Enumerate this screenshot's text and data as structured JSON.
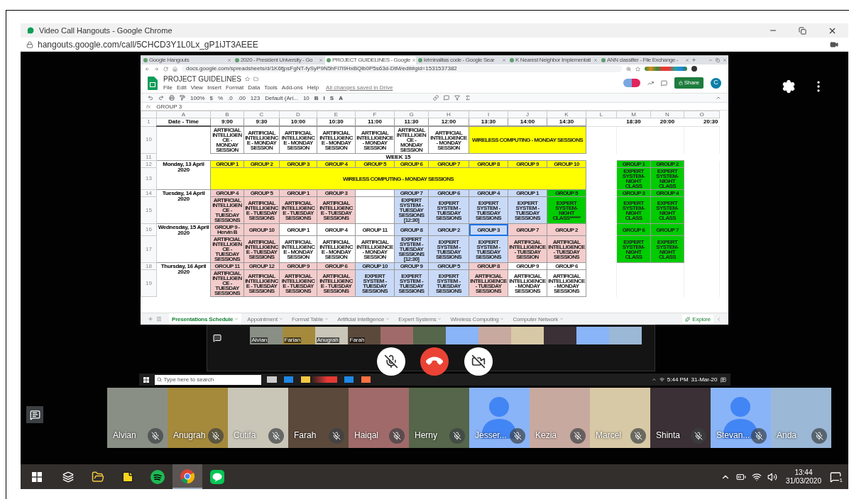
{
  "window": {
    "title": "Video Call Hangouts - Google Chrome",
    "url": "hangouts.google.com/call/5CHCD3Y1L0Lx_gP1iJT3AEEE"
  },
  "shared_screen": {
    "browser_tabs": [
      {
        "title": "Google Hangouts",
        "selected": false
      },
      {
        "title": "2020 - President University - Go",
        "selected": false
      },
      {
        "title": "PROJECT GUIDELINES - Google",
        "selected": true
      },
      {
        "title": "kriminalitas code - Google Sear",
        "selected": false
      },
      {
        "title": "K Nearest Neighbor Implementati",
        "selected": false
      },
      {
        "title": "ANN classifier - File Exchange -",
        "selected": false
      }
    ],
    "url": "docs.google.com/spreadsheets/d/1K6fjpsFgNT-fySyP9N5hFi7l9HxBQlb0P5s63d-DtM/edit#gid=1531537382",
    "doc_title": "PROJECT GUIDELINES",
    "menu": [
      "File",
      "Edit",
      "View",
      "Insert",
      "Format",
      "Data",
      "Tools",
      "Add-ons",
      "Help"
    ],
    "save_status": "All changes saved in Drive",
    "share": "Share",
    "account": "C",
    "toolbar": [
      "100%",
      "$",
      "%",
      ".0",
      ".00",
      "123",
      "Default (Ari...",
      "10",
      "B",
      "I",
      "S",
      "A"
    ],
    "formula_label": "fx",
    "formula": "GROUP 3",
    "columns": [
      "A",
      "B",
      "C",
      "D",
      "E",
      "F",
      "G",
      "H",
      "I",
      "J",
      "K",
      "L",
      "M",
      "N",
      "O"
    ],
    "rows": [
      {
        "number": "1",
        "kind": "header",
        "date": "Date - Time",
        "times": [
          "9:00",
          "9:30",
          "10:00",
          "10:30",
          "11:00",
          "11:30",
          "12:00",
          "13:30",
          "14:00",
          "14:30"
        ],
        "night_times": [
          "18:30",
          "20:00",
          "20:30"
        ]
      },
      {
        "number": "10",
        "kind": "schedule",
        "cells": [
          {
            "kind": "cell",
            "text": "ARTIFICIAL INTELLIGENCE - MONDAY SESSION",
            "color": "#ffffff",
            "selected": false
          },
          {
            "kind": "cell",
            "text": "ARTIFICIAL INTELLIGENCE - MONDAY SESSION",
            "color": "#ffffff",
            "selected": false
          },
          {
            "kind": "cell",
            "text": "ARTIFICIAL INTELLIGENCE - MONDAY SESSION",
            "color": "#ffffff",
            "selected": false
          },
          {
            "kind": "cell",
            "text": "ARTIFICIAL INTELLIGENCE - MONDAY SESSION",
            "color": "#ffffff",
            "selected": false
          },
          {
            "kind": "cell",
            "text": "ARTIFICIAL INTELLIGENCE - MONDAY SESSION",
            "color": "#ffffff",
            "selected": false
          },
          {
            "kind": "cell",
            "text": "ARTIFICIAL INTELLIGENCE - MONDAY SESSION",
            "color": "#ffffff",
            "selected": false
          },
          {
            "kind": "cell",
            "text": "ARTIFICIAL INTELLIGENCE - MONDAY SESSION",
            "color": "#ffffff",
            "selected": false
          },
          {
            "kind": "wide",
            "text": "WIRELESS COMPUTING - MONDAY SESSIONS",
            "color": "#ffff00",
            "selected": false
          }
        ]
      },
      {
        "number": "11",
        "kind": "banner",
        "text": "WEEK 15"
      },
      {
        "number": "12",
        "kind": "schedule",
        "date": "Monday, 13 April 2020",
        "cells": [
          {
            "kind": "cell",
            "text": "GROUP 1",
            "color": "#ffff00",
            "selected": false
          },
          {
            "kind": "cell",
            "text": "GROUP 2",
            "color": "#ffff00",
            "selected": false
          },
          {
            "kind": "cell",
            "text": "GROUP 3",
            "color": "#ffff00",
            "selected": false
          },
          {
            "kind": "cell",
            "text": "GROUP 4",
            "color": "#ffff00",
            "selected": false
          },
          {
            "kind": "cell",
            "text": "GROUP 5",
            "color": "#ffff00",
            "selected": false
          },
          {
            "kind": "cell",
            "text": "GROUP 6",
            "color": "#ffff00",
            "selected": false
          },
          {
            "kind": "cell",
            "text": "GROUP 7",
            "color": "#ffff00",
            "selected": false
          },
          {
            "kind": "cell",
            "text": "GROUP 8",
            "color": "#ffff00",
            "selected": false
          },
          {
            "kind": "cell",
            "text": "GROUP 9",
            "color": "#ffff00",
            "selected": false
          },
          {
            "kind": "cell",
            "text": "GROUP 10",
            "color": "#ffff00",
            "selected": false
          }
        ],
        "night": [
          {
            "text": "GROUP 1",
            "color": "#00cc00",
            "selected": false
          },
          {
            "text": "GROUP 2",
            "color": "#00cc00",
            "selected": false
          }
        ]
      },
      {
        "number": "13",
        "kind": "schedule",
        "cells": [
          {
            "kind": "wide",
            "text": "WIRELESS COMPUTING - MONDAY SESSIONS",
            "color": "#ffff00",
            "selected": false
          }
        ],
        "night": [
          {
            "text": "EXPERT SYSTEM- NIGHT CLASS",
            "color": "#00cc00",
            "selected": false
          },
          {
            "text": "EXPERT SYSTEM- NIGHT CLASS",
            "color": "#00cc00",
            "selected": false
          }
        ]
      },
      {
        "number": "14",
        "kind": "schedule",
        "date": "Tuesday, 14 April 2020",
        "cells": [
          {
            "kind": "cell",
            "text": "GROUP 4",
            "color": "#f4cccc",
            "selected": false
          },
          {
            "kind": "cell",
            "text": "GROUP 5",
            "color": "#f4cccc",
            "selected": false
          },
          {
            "kind": "cell",
            "text": "GROUP 1",
            "color": "#f4cccc",
            "selected": false
          },
          {
            "kind": "cell",
            "text": "GROUP 3",
            "color": "#f4cccc",
            "selected": false
          },
          {
            "kind": "blank",
            "color": "#ffffff",
            "selected": false
          },
          {
            "kind": "cell",
            "text": "GROUP 7",
            "color": "#c9daf8",
            "selected": false
          },
          {
            "kind": "cell",
            "text": "GROUP 6",
            "color": "#c9daf8",
            "selected": false
          },
          {
            "kind": "cell",
            "text": "GROUP 4",
            "color": "#c9daf8",
            "selected": false
          },
          {
            "kind": "cell",
            "text": "GROUP 1",
            "color": "#c9daf8",
            "selected": false
          },
          {
            "kind": "cell",
            "text": "GROUP 5",
            "color": "#00cc00",
            "selected": false
          }
        ],
        "night": [
          {
            "text": "GROUP 3",
            "color": "#00cc00",
            "selected": false
          },
          {
            "text": "GROUP 4",
            "color": "#00cc00",
            "selected": false
          }
        ]
      },
      {
        "number": "15",
        "kind": "schedule",
        "cells": [
          {
            "kind": "cell",
            "text": "ARTIFICIAL INTELLIGENCE - TUESDAY SESSIONS",
            "color": "#f4cccc",
            "selected": false
          },
          {
            "kind": "cell",
            "text": "ARTIFICIAL INTELLIGENCE - TUESDAY SESSIONS",
            "color": "#f4cccc",
            "selected": false
          },
          {
            "kind": "cell",
            "text": "ARTIFICIAL INTELLIGENCE - TUESDAY SESSIONS",
            "color": "#f4cccc",
            "selected": false
          },
          {
            "kind": "cell",
            "text": "ARTIFICIAL INTELLIGENCE - TUESDAY SESSIONS",
            "color": "#f4cccc",
            "selected": false
          },
          {
            "kind": "blank",
            "color": "#ffffff",
            "selected": false
          },
          {
            "kind": "cell",
            "text": "EXPERT SYSTEM - TUESDAY SESSIONS [12:30]",
            "color": "#c9daf8",
            "selected": false
          },
          {
            "kind": "cell",
            "text": "EXPERT SYSTEM - TUESDAY SESSIONS",
            "color": "#c9daf8",
            "selected": false
          },
          {
            "kind": "cell",
            "text": "EXPERT SYSTEM - TUESDAY SESSIONS",
            "color": "#c9daf8",
            "selected": false
          },
          {
            "kind": "cell",
            "text": "EXPERT SYSTEM - TUESDAY SESSIONS",
            "color": "#c9daf8",
            "selected": false
          },
          {
            "kind": "cell",
            "text": "EXPERT SYSTEM- NIGHT CLASS******",
            "color": "#00cc00",
            "selected": false
          }
        ],
        "night": [
          {
            "text": "EXPERT SYSTEM- NIGHT CLASS",
            "color": "#00cc00",
            "selected": false
          },
          {
            "text": "EXPERT SYSTEM- NIGHT CLASS",
            "color": "#00cc00",
            "selected": false
          }
        ]
      },
      {
        "number": "16",
        "kind": "schedule",
        "date": "Wednesday, 15 April 2020",
        "cells": [
          {
            "kind": "cell",
            "text": "GROUP 9 - Hervin B",
            "color": "#f4cccc",
            "selected": false
          },
          {
            "kind": "cell",
            "text": "GROUP 10",
            "color": "#f4cccc",
            "selected": false
          },
          {
            "kind": "cell",
            "text": "GROUP 1",
            "color": "#ffffff",
            "selected": false
          },
          {
            "kind": "cell",
            "text": "GROUP 4",
            "color": "#ffffff",
            "selected": false
          },
          {
            "kind": "cell",
            "text": "GROUP 11",
            "color": "#ffffff",
            "selected": false
          },
          {
            "kind": "cell",
            "text": "GROUP 8",
            "color": "#c9daf8",
            "selected": false
          },
          {
            "kind": "cell",
            "text": "GROUP 2",
            "color": "#c9daf8",
            "selected": false
          },
          {
            "kind": "cell",
            "text": "GROUP 3",
            "color": "#c9daf8",
            "selected": true
          },
          {
            "kind": "cell",
            "text": "GROUP 7",
            "color": "#f4cccc",
            "selected": false
          },
          {
            "kind": "cell",
            "text": "GROUP 2",
            "color": "#f4cccc",
            "selected": false
          }
        ],
        "night": [
          {
            "text": "GROUP 6",
            "color": "#00cc00",
            "selected": false
          },
          {
            "text": "GROUP 7",
            "color": "#00cc00",
            "selected": false
          }
        ]
      },
      {
        "number": "17",
        "kind": "schedule",
        "cells": [
          {
            "kind": "cell",
            "text": "ARTIFICIAL INTELLIGENCE - TUESDAY SESSIONS",
            "color": "#f4cccc",
            "selected": false
          },
          {
            "kind": "cell",
            "text": "ARTIFICIAL INTELLIGENCE - TUESDAY SESSIONS",
            "color": "#f4cccc",
            "selected": false
          },
          {
            "kind": "cell",
            "text": "ARTIFICIAL INTELLIGENCE - MONDAY SESSION",
            "color": "#ffffff",
            "selected": false
          },
          {
            "kind": "cell",
            "text": "ARTIFICIAL INTELLIGENCE - MONDAY SESSION",
            "color": "#ffffff",
            "selected": false
          },
          {
            "kind": "cell",
            "text": "ARTIFICIAL INTELLIGENCE - MONDAY SESSION",
            "color": "#ffffff",
            "selected": false
          },
          {
            "kind": "cell",
            "text": "EXPERT SYSTEM - TUESDAY SESSIONS [12:30]",
            "color": "#c9daf8",
            "selected": false
          },
          {
            "kind": "cell",
            "text": "EXPERT SYSTEM - TUESDAY SESSIONS",
            "color": "#c9daf8",
            "selected": false
          },
          {
            "kind": "cell",
            "text": "EXPERT SYSTEM - TUESDAY SESSIONS",
            "color": "#c9daf8",
            "selected": false
          },
          {
            "kind": "cell",
            "text": "ARTIFICIAL INTELLIGENCE - TUESDAY SESSION",
            "color": "#f4cccc",
            "selected": false
          },
          {
            "kind": "cell",
            "text": "ARTIFICIAL INTELLIGENCE - TUESDAY SESSIONS",
            "color": "#f4cccc",
            "selected": false
          }
        ],
        "night": [
          {
            "text": "EXPERT SYSTEM- NIGHT CLASS",
            "color": "#00cc00",
            "selected": false
          },
          {
            "text": "EXPERT SYSTEM- NIGHT CLASS",
            "color": "#00cc00",
            "selected": false
          }
        ]
      },
      {
        "number": "18",
        "kind": "schedule",
        "date": "Thursday, 16 April 2020",
        "cells": [
          {
            "kind": "cell",
            "text": "GROUP 11",
            "color": "#f4cccc",
            "selected": false
          },
          {
            "kind": "cell",
            "text": "GROUP 12",
            "color": "#f4cccc",
            "selected": false
          },
          {
            "kind": "cell",
            "text": "GROUP 9",
            "color": "#f4cccc",
            "selected": false
          },
          {
            "kind": "cell",
            "text": "GROUP 6",
            "color": "#f4cccc",
            "selected": false
          },
          {
            "kind": "cell",
            "text": "GROUP 10",
            "color": "#c9daf8",
            "selected": false
          },
          {
            "kind": "cell",
            "text": "GROUP 9",
            "color": "#c9daf8",
            "selected": false
          },
          {
            "kind": "cell",
            "text": "GROUP 5",
            "color": "#c9daf8",
            "selected": false
          },
          {
            "kind": "cell",
            "text": "GROUP 8",
            "color": "#f4cccc",
            "selected": false
          },
          {
            "kind": "cell",
            "text": "GROUP 9",
            "color": "#ffffff",
            "selected": false
          },
          {
            "kind": "cell",
            "text": "GROUP 6",
            "color": "#ffffff",
            "selected": false
          }
        ]
      },
      {
        "number": "19",
        "kind": "schedule",
        "cells": [
          {
            "kind": "cell",
            "text": "ARTIFICIAL INTELLIGENCE - TUESDAY SESSIONS",
            "color": "#f4cccc",
            "selected": false
          },
          {
            "kind": "cell",
            "text": "ARTIFICIAL INTELLIGENCE - TUESDAY SESSIONS",
            "color": "#f4cccc",
            "selected": false
          },
          {
            "kind": "cell",
            "text": "ARTIFICIAL INTELLIGENCE - TUESDAY SESSIONS",
            "color": "#f4cccc",
            "selected": false
          },
          {
            "kind": "cell",
            "text": "ARTIFICIAL INTELLIGENCE - TUESDAY SESSIONS",
            "color": "#f4cccc",
            "selected": false
          },
          {
            "kind": "cell",
            "text": "EXPERT SYSTEM - TUESDAY SESSIONS",
            "color": "#c9daf8",
            "selected": false
          },
          {
            "kind": "cell",
            "text": "EXPERT SYSTEM - TUESDAY SESSIONS",
            "color": "#c9daf8",
            "selected": false
          },
          {
            "kind": "cell",
            "text": "EXPERT SYSTEM - TUESDAY SESSIONS",
            "color": "#c9daf8",
            "selected": false
          },
          {
            "kind": "cell",
            "text": "ARTIFICIAL INTELLIGENCE - TUESDAY SESSIONS",
            "color": "#f4cccc",
            "selected": false
          },
          {
            "kind": "cell",
            "text": "ARTIFICIAL INTELLIGENCE - MONDAY SESSIONS",
            "color": "#ffffff",
            "selected": false
          },
          {
            "kind": "cell",
            "text": "ARTIFICIAL INTELLIGENCE - MONDAY SESSIONS",
            "color": "#ffffff",
            "selected": false
          }
        ]
      }
    ],
    "sheet_tabs": [
      {
        "label": "Presentations Schedule",
        "selected": true
      },
      {
        "label": "Appointment",
        "selected": false
      },
      {
        "label": "Format Table",
        "selected": false
      },
      {
        "label": "Artificial Intelligence",
        "selected": false
      },
      {
        "label": "Expert Systems",
        "selected": false
      },
      {
        "label": "Wireless Computing",
        "selected": false
      },
      {
        "label": "Computer Network",
        "selected": false
      }
    ],
    "explore": "Explore"
  },
  "inner_call": {
    "tiles": [
      {
        "kind": "photo",
        "name": "Alvian"
      },
      {
        "kind": "photo",
        "name": "Farian"
      },
      {
        "kind": "photo",
        "name": "Anugrah"
      },
      {
        "kind": "photo",
        "name": "Farah"
      },
      {
        "kind": "photo"
      },
      {
        "kind": "photo"
      },
      {
        "kind": "avatar"
      },
      {
        "kind": "photo"
      },
      {
        "kind": "photo"
      },
      {
        "kind": "photo"
      },
      {
        "kind": "avatar"
      },
      {
        "kind": "photo"
      }
    ],
    "search_placeholder": "Type here to search",
    "time": "5:44 PM",
    "date": "31-Mar-20"
  },
  "participants": [
    {
      "name": "Alvian",
      "kind": "photo",
      "muted": true
    },
    {
      "name": "Anugrah",
      "kind": "photo",
      "muted": true
    },
    {
      "name": "Cutifa",
      "kind": "photo",
      "muted": true
    },
    {
      "name": "Farah",
      "kind": "photo",
      "muted": true
    },
    {
      "name": "Haiqal",
      "kind": "photo",
      "muted": true
    },
    {
      "name": "Herny",
      "kind": "photo",
      "muted": true
    },
    {
      "name": "Jesser...",
      "kind": "avatar",
      "muted": true
    },
    {
      "name": "Kezia",
      "kind": "photo",
      "muted": true
    },
    {
      "name": "Marcel",
      "kind": "photo",
      "muted": true
    },
    {
      "name": "Shinta",
      "kind": "photo",
      "muted": true
    },
    {
      "name": "Stevan...",
      "kind": "avatar",
      "muted": true
    },
    {
      "name": "Anda",
      "kind": "photo",
      "muted": true
    }
  ],
  "taskbar": {
    "apps": [
      {
        "kind": "taskview",
        "selected": false
      },
      {
        "kind": "explorer",
        "selected": false
      },
      {
        "kind": "notes",
        "selected": false
      },
      {
        "kind": "spotify",
        "selected": false
      },
      {
        "kind": "chrome",
        "selected": true
      },
      {
        "kind": "line",
        "selected": false
      }
    ],
    "time": "13:44",
    "date": "31/03/2020",
    "notifications": "1"
  }
}
